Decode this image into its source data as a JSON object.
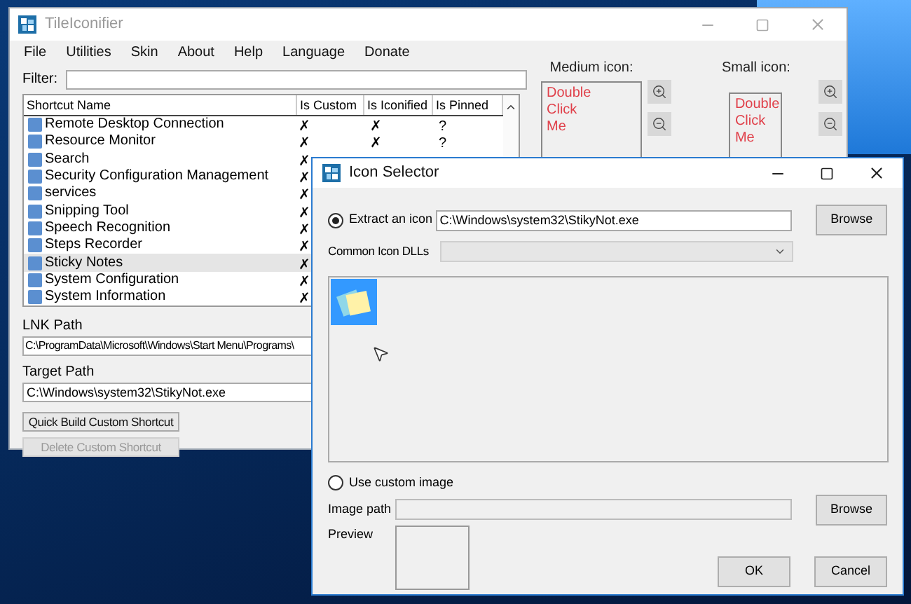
{
  "main_window": {
    "title": "TileIconifier",
    "menu": [
      "File",
      "Utilities",
      "Skin",
      "About",
      "Help",
      "Language",
      "Donate"
    ],
    "filter_label": "Filter:",
    "table": {
      "columns": [
        "Shortcut Name",
        "Is Custom",
        "Is Iconified",
        "Is Pinned"
      ],
      "rows": [
        {
          "name": "Remote Desktop Connection",
          "is_custom": "✗",
          "is_iconified": "✗",
          "is_pinned": "?",
          "selected": false
        },
        {
          "name": "Resource Monitor",
          "is_custom": "✗",
          "is_iconified": "✗",
          "is_pinned": "?",
          "selected": false
        },
        {
          "name": "Search",
          "is_custom": "✗",
          "selected": false
        },
        {
          "name": "Security Configuration Management",
          "is_custom": "✗",
          "selected": false
        },
        {
          "name": "services",
          "is_custom": "✗",
          "selected": false
        },
        {
          "name": "Snipping Tool",
          "is_custom": "✗",
          "selected": false
        },
        {
          "name": "Speech Recognition",
          "is_custom": "✗",
          "selected": false
        },
        {
          "name": "Steps Recorder",
          "is_custom": "✗",
          "selected": false
        },
        {
          "name": "Sticky Notes",
          "is_custom": "✗",
          "selected": true
        },
        {
          "name": "System Configuration",
          "is_custom": "✗",
          "selected": false
        },
        {
          "name": "System Information",
          "is_custom": "✗",
          "selected": false
        }
      ]
    },
    "lnk_path": {
      "label": "LNK Path",
      "value": "C:\\ProgramData\\Microsoft\\Windows\\Start Menu\\Programs\\"
    },
    "target_path": {
      "label": "Target Path",
      "value": "C:\\Windows\\system32\\StikyNot.exe"
    },
    "buttons": [
      {
        "label": "Quick Build Custom Shortcut",
        "disabled": false
      },
      {
        "label": "Delete Custom Shortcut",
        "disabled": true
      }
    ],
    "medium_icon": {
      "label": "Medium icon:",
      "lines": [
        "Double",
        "Click",
        "Me"
      ]
    },
    "small_icon": {
      "label": "Small icon:",
      "lines": [
        "Double",
        "Click",
        "Me"
      ]
    }
  },
  "dialog": {
    "title": "Icon Selector",
    "extract_option": {
      "label": "Extract an icon",
      "selected": true,
      "path": "C:\\Windows\\system32\\StikyNot.exe",
      "button": "Browse"
    },
    "dlls_label": "Common Icon DLLs",
    "icons": [
      {
        "selected": true
      }
    ],
    "custom_option": {
      "label": "Use custom image",
      "selected": false
    },
    "image_path": {
      "label": "Image path",
      "button": "Browse"
    },
    "preview_label": "Preview",
    "buttons": [
      "OK",
      "Cancel"
    ]
  }
}
